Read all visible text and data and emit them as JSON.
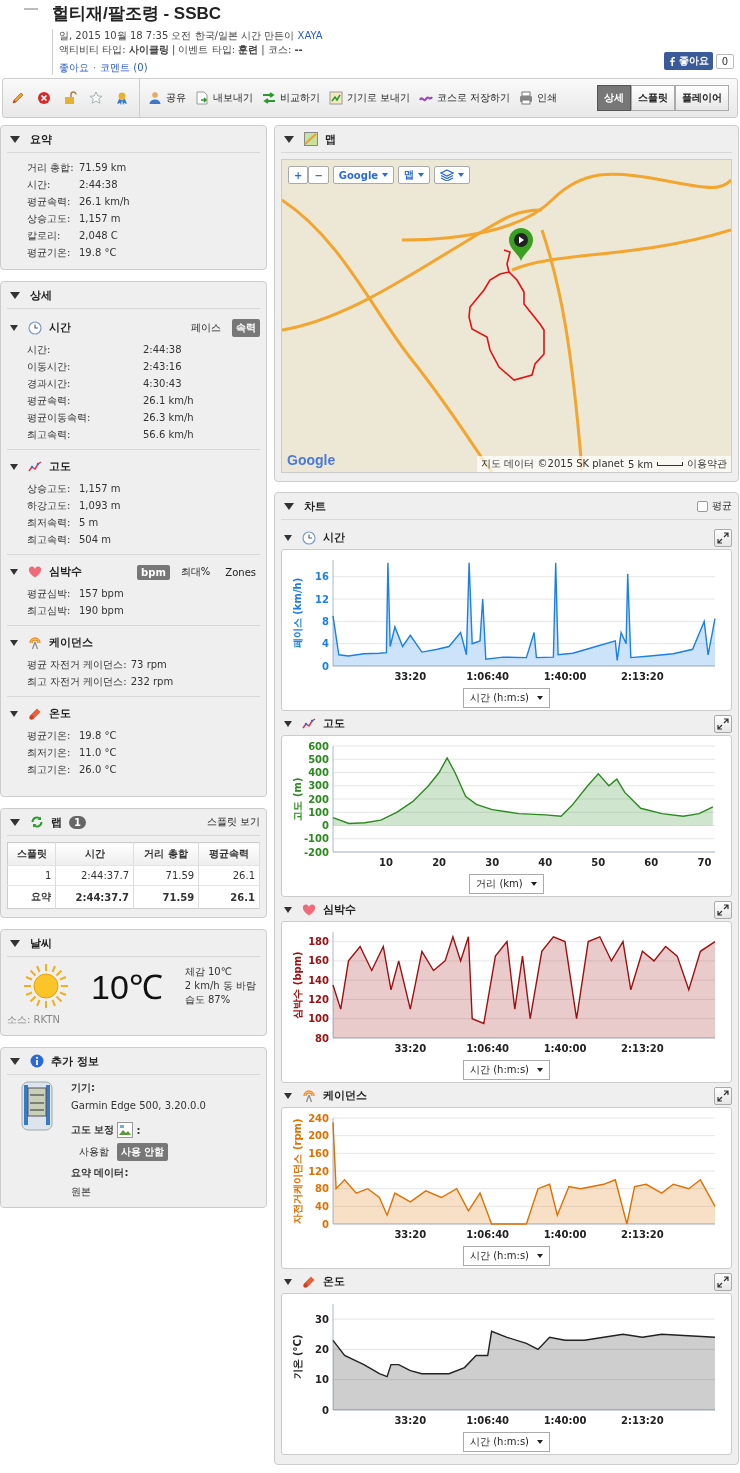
{
  "header": {
    "title": "헐티재/팔조령 - SSBC",
    "meta": "일, 2015 10월 18 7:35 오전 한국/일본 시간 만든이",
    "author": "XAYA",
    "activity_line": "액티비티 타입: **사이클링** | 이벤트 타입: **훈련** | 코스: **--**",
    "like_link": "좋아요",
    "separator": "·",
    "comment_link": "코멘트 (0)",
    "fb_like": "좋아요",
    "fb_count": "0"
  },
  "toolbar": {
    "actions": [
      {
        "kind": "share",
        "label": "공유"
      },
      {
        "kind": "export",
        "label": "내보내기"
      },
      {
        "kind": "compare",
        "label": "비교하기"
      },
      {
        "kind": "device",
        "label": "기기로 보내기"
      },
      {
        "kind": "course",
        "label": "코스로 저장하기"
      },
      {
        "kind": "print",
        "label": "인쇄"
      }
    ],
    "views": [
      {
        "label": "상세",
        "selected": true
      },
      {
        "label": "스플릿",
        "selected": false
      },
      {
        "label": "플레이어",
        "selected": false
      }
    ]
  },
  "summary": {
    "title": "요약",
    "rows": [
      {
        "label": "거리 총합:",
        "value": "71.59 km"
      },
      {
        "label": "시간:",
        "value": "2:44:38"
      },
      {
        "label": "평균속력:",
        "value": "26.1 km/h"
      },
      {
        "label": "상승고도:",
        "value": "1,157 m"
      },
      {
        "label": "칼로리:",
        "value": "2,048 C"
      },
      {
        "label": "평균기온:",
        "value": "19.8 °C"
      }
    ]
  },
  "details": {
    "title": "상세",
    "sections": [
      {
        "kind": "time",
        "title": "시간",
        "toggles": [
          {
            "label": "페이스",
            "selected": false
          },
          {
            "label": "속력",
            "selected": true
          }
        ],
        "rows": [
          {
            "label": "시간:",
            "value": "2:44:38"
          },
          {
            "label": "이동시간:",
            "value": "2:43:16"
          },
          {
            "label": "경과시간:",
            "value": "4:30:43"
          },
          {
            "label": "평균속력:",
            "value": "26.1 km/h"
          },
          {
            "label": "평균이동속력:",
            "value": "26.3 km/h"
          },
          {
            "label": "최고속력:",
            "value": "56.6 km/h"
          }
        ]
      },
      {
        "kind": "elevation",
        "title": "고도",
        "rows": [
          {
            "label": "상승고도:",
            "value": "1,157 m"
          },
          {
            "label": "하강고도:",
            "value": "1,093 m"
          },
          {
            "label": "최저속력:",
            "value": "5 m"
          },
          {
            "label": "최고속력:",
            "value": "504 m"
          }
        ]
      },
      {
        "kind": "heart",
        "title": "심박수",
        "toggles": [
          {
            "label": "bpm",
            "selected": true
          },
          {
            "label": "최대%",
            "selected": false
          },
          {
            "label": "Zones",
            "selected": false
          }
        ],
        "rows": [
          {
            "label": "평균심박:",
            "value": "157 bpm"
          },
          {
            "label": "최고심박:",
            "value": "190 bpm"
          }
        ]
      },
      {
        "kind": "cadence",
        "title": "케이던스",
        "rows": [
          {
            "label": "평균 자전거 케이던스:",
            "value": "73 rpm"
          },
          {
            "label": "최고 자전거 케이던스:",
            "value": "232 rpm"
          }
        ]
      },
      {
        "kind": "temperature",
        "title": "온도",
        "rows": [
          {
            "label": "평균기온:",
            "value": "19.8 °C"
          },
          {
            "label": "최저기온:",
            "value": "11.0 °C"
          },
          {
            "label": "최고기온:",
            "value": "26.0 °C"
          }
        ]
      }
    ]
  },
  "laps": {
    "title": "랩",
    "count": "1",
    "link": "스플릿 보기",
    "columns": [
      "스플릿",
      "시간",
      "거리 총합",
      "평균속력"
    ],
    "rows": [
      {
        "kind": "lap",
        "cells": [
          "1",
          "2:44:37.7",
          "71.59",
          "26.1"
        ]
      },
      {
        "kind": "summary",
        "cells": [
          "요약",
          "2:44:37.7",
          "71.59",
          "26.1"
        ]
      }
    ]
  },
  "weather": {
    "title": "날씨",
    "temperature": "10℃",
    "lines": [
      "체감 10℃",
      "2 km/h 동 바람",
      "습도 87%"
    ],
    "source": "소스: RKTN"
  },
  "info": {
    "title": "추가 정보",
    "device_label": "기기:",
    "device": "Garmin Edge 500, 3.20.0.0",
    "elevation_label": "고도 보정",
    "colon": ":",
    "options": [
      {
        "label": "사용함",
        "selected": false
      },
      {
        "label": "사용 안함",
        "selected": true
      }
    ],
    "summary_label": "요약 데이터:",
    "summary_value": "원본"
  },
  "map": {
    "title": "맵",
    "zoom_in": "+",
    "zoom_out": "−",
    "provider": "Google",
    "type": "맵",
    "attribution": "지도 데이터 ©2015 SK planet",
    "scale": "5 km",
    "terms": "이용약관",
    "logo": "Google"
  },
  "charts": {
    "title": "차트",
    "average": {
      "label": "평균",
      "checked": false
    },
    "items": [
      {
        "kind": "time",
        "title": "시간",
        "axis_select": "시간 (h:m:s)",
        "chart_data": {
          "type": "area",
          "ylabel": "페이스 (km/h)",
          "grid": true,
          "xlim": [
            0,
            9878
          ],
          "ylim": [
            0,
            19
          ],
          "xticks": [
            {
              "value": 2000,
              "label": "33:20"
            },
            {
              "value": 4000,
              "label": "1:06:40"
            },
            {
              "value": 6000,
              "label": "1:40:00"
            },
            {
              "value": 8000,
              "label": "2:13:20"
            }
          ],
          "yticks": [
            0,
            4,
            8,
            12,
            16
          ],
          "x": [
            0,
            150,
            400,
            800,
            1200,
            1380,
            1420,
            1480,
            1600,
            1800,
            2000,
            2300,
            2700,
            3000,
            3300,
            3450,
            3520,
            3600,
            3800,
            3870,
            3950,
            4400,
            5000,
            5200,
            5260,
            5700,
            5760,
            5820,
            6200,
            6800,
            7300,
            7350,
            7450,
            7580,
            7620,
            7700,
            8200,
            8800,
            9300,
            9600,
            9700,
            9878
          ],
          "series": [
            {
              "color": "#1a7fe8",
              "values": [
                9,
                2,
                1.8,
                2.2,
                2.3,
                2.4,
                18.5,
                3.5,
                7,
                3.5,
                5.5,
                2.5,
                3,
                3.5,
                6,
                2,
                18.5,
                4,
                4.5,
                12,
                1.2,
                1.6,
                1.5,
                6,
                1.5,
                1.6,
                18.5,
                2,
                2.3,
                3.5,
                4.5,
                1,
                6,
                4,
                16.5,
                1.5,
                1.8,
                2.2,
                3,
                8,
                2,
                8.5
              ]
            }
          ]
        }
      },
      {
        "kind": "elevation",
        "title": "고도",
        "axis_select": "거리 (km)",
        "chart_data": {
          "type": "area",
          "ylabel": "고도 (m)",
          "grid": true,
          "xlim": [
            0,
            72
          ],
          "ylim": [
            -200,
            600
          ],
          "xticks": [
            10,
            20,
            30,
            40,
            50,
            60,
            70
          ],
          "yticks": [
            -200,
            -100,
            0,
            100,
            200,
            300,
            400,
            500,
            600
          ],
          "x": [
            0,
            3,
            6,
            9,
            12,
            15,
            18,
            20,
            21.5,
            23,
            25,
            27,
            30,
            35,
            40,
            43,
            45,
            48,
            50,
            52,
            53.5,
            55,
            58,
            62,
            66,
            69,
            71.6
          ],
          "series": [
            {
              "color": "#2b8a1e",
              "values": [
                60,
                15,
                20,
                40,
                100,
                180,
                300,
                400,
                510,
                400,
                220,
                160,
                120,
                90,
                80,
                70,
                150,
                300,
                390,
                300,
                350,
                250,
                130,
                90,
                70,
                90,
                140
              ]
            }
          ]
        }
      },
      {
        "kind": "heart",
        "title": "심박수",
        "axis_select": "시간 (h:m:s)",
        "chart_data": {
          "type": "area",
          "ylabel": "심박수 (bpm)",
          "grid": true,
          "xlim": [
            0,
            9878
          ],
          "ylim": [
            80,
            190
          ],
          "xticks": [
            {
              "value": 2000,
              "label": "33:20"
            },
            {
              "value": 4000,
              "label": "1:06:40"
            },
            {
              "value": 6000,
              "label": "1:40:00"
            },
            {
              "value": 8000,
              "label": "2:13:20"
            }
          ],
          "yticks": [
            80,
            100,
            120,
            140,
            160,
            180
          ],
          "x": [
            0,
            200,
            400,
            700,
            1000,
            1300,
            1500,
            1700,
            2000,
            2300,
            2600,
            2900,
            3100,
            3300,
            3500,
            3600,
            3900,
            4200,
            4500,
            4700,
            4900,
            5100,
            5400,
            5700,
            6000,
            6300,
            6600,
            6900,
            7200,
            7500,
            7700,
            8000,
            8300,
            8600,
            8900,
            9200,
            9500,
            9878
          ],
          "series": [
            {
              "color": "#a01010",
              "values": [
                135,
                110,
                160,
                175,
                150,
                175,
                130,
                160,
                110,
                170,
                150,
                160,
                185,
                160,
                185,
                100,
                95,
                165,
                180,
                110,
                165,
                100,
                170,
                185,
                180,
                100,
                180,
                185,
                160,
                180,
                130,
                170,
                160,
                175,
                165,
                130,
                170,
                180
              ]
            }
          ]
        }
      },
      {
        "kind": "cadence",
        "title": "케이던스",
        "axis_select": "시간 (h:m:s)",
        "chart_data": {
          "type": "area",
          "ylabel": "자전거케이던스 (rpm)",
          "grid": true,
          "xlim": [
            0,
            9878
          ],
          "ylim": [
            0,
            240
          ],
          "xticks": [
            {
              "value": 2000,
              "label": "33:20"
            },
            {
              "value": 4000,
              "label": "1:06:40"
            },
            {
              "value": 6000,
              "label": "1:40:00"
            },
            {
              "value": 8000,
              "label": "2:13:20"
            }
          ],
          "yticks": [
            0,
            40,
            80,
            120,
            160,
            200,
            240
          ],
          "x": [
            0,
            80,
            300,
            600,
            900,
            1200,
            1400,
            1600,
            2000,
            2400,
            2800,
            3200,
            3500,
            3800,
            4100,
            4500,
            5000,
            5300,
            5600,
            5800,
            6100,
            6400,
            6700,
            7000,
            7300,
            7600,
            7800,
            8100,
            8500,
            8800,
            9200,
            9500,
            9878
          ],
          "series": [
            {
              "color": "#e07000",
              "values": [
                230,
                80,
                100,
                70,
                80,
                60,
                20,
                70,
                50,
                75,
                60,
                80,
                30,
                70,
                0,
                0,
                0,
                80,
                90,
                20,
                85,
                80,
                85,
                90,
                100,
                0,
                85,
                90,
                70,
                90,
                80,
                100,
                40
              ]
            }
          ]
        }
      },
      {
        "kind": "temperature",
        "title": "온도",
        "axis_select": "시간 (h:m:s)",
        "chart_data": {
          "type": "area",
          "ylabel": "기온 (°C)",
          "grid": true,
          "xlim": [
            0,
            9878
          ],
          "ylim": [
            0,
            35
          ],
          "xticks": [
            {
              "value": 2000,
              "label": "33:20"
            },
            {
              "value": 4000,
              "label": "1:06:40"
            },
            {
              "value": 6000,
              "label": "1:40:00"
            },
            {
              "value": 8000,
              "label": "2:13:20"
            }
          ],
          "yticks": [
            0,
            10,
            20,
            30
          ],
          "x": [
            0,
            300,
            800,
            1200,
            1400,
            1500,
            1700,
            2000,
            2300,
            3000,
            3400,
            3700,
            4000,
            4100,
            4500,
            5000,
            5300,
            5600,
            6000,
            6500,
            7000,
            7500,
            8000,
            8500,
            9878
          ],
          "series": [
            {
              "color": "#222222",
              "values": [
                23,
                18,
                15,
                12,
                11,
                15,
                15,
                13,
                12,
                12,
                14,
                18,
                18,
                26,
                24,
                22,
                20,
                24,
                23,
                23,
                24,
                25,
                24,
                25,
                24
              ]
            }
          ]
        }
      }
    ]
  }
}
